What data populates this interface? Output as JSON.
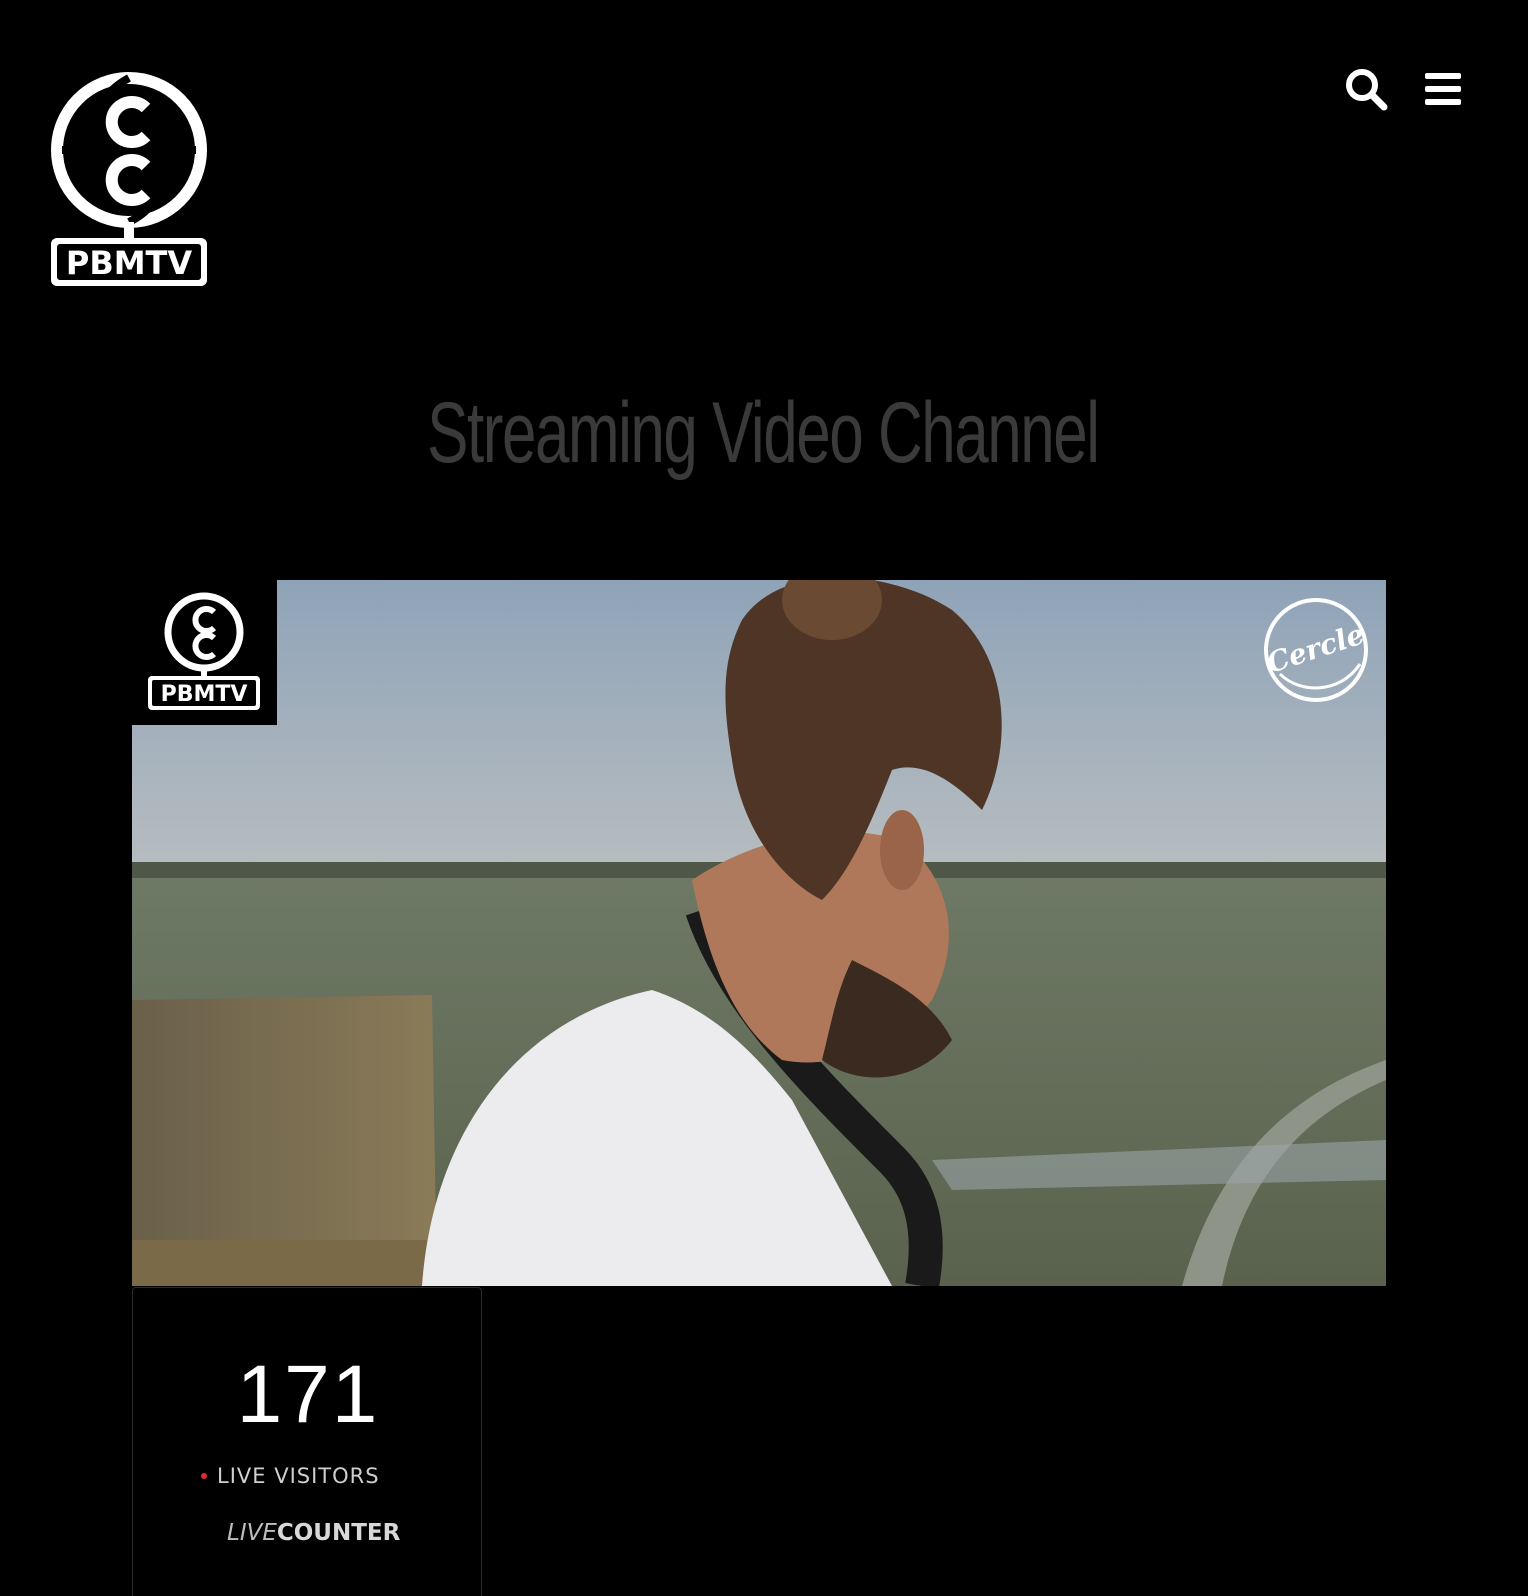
{
  "header": {
    "logo_text": "PBMTV",
    "search_icon": "search-icon",
    "menu_icon": "hamburger-menu-icon"
  },
  "main": {
    "title": "Streaming Video Channel",
    "video": {
      "badge_text": "PBMTV",
      "watermark_text": "Cercle"
    }
  },
  "counter": {
    "value": "171",
    "label": "LIVE VISITORS",
    "brand_live": "LIVE",
    "brand_counter": "COUNTER",
    "dot_color": "#e02a2a"
  }
}
